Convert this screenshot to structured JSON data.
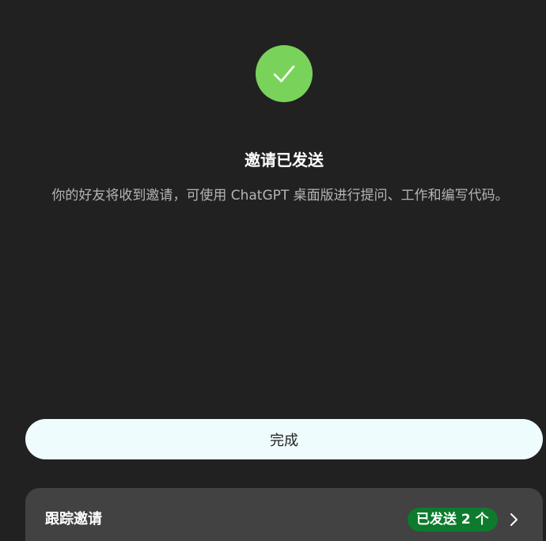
{
  "confirmation": {
    "icon": "check-icon",
    "title": "邀请已发送",
    "description": "你的好友将收到邀请，可使用 ChatGPT 桌面版进行提问、工作和编写代码。"
  },
  "actions": {
    "done_label": "完成"
  },
  "track_invites": {
    "label": "跟踪邀请",
    "badge": "已发送 2 个",
    "chevron_icon": "chevron-right-icon"
  },
  "colors": {
    "background": "#212121",
    "success": "#79d35a",
    "badge": "#0e7a2d",
    "card": "#424242",
    "button": "#eefcfd"
  }
}
